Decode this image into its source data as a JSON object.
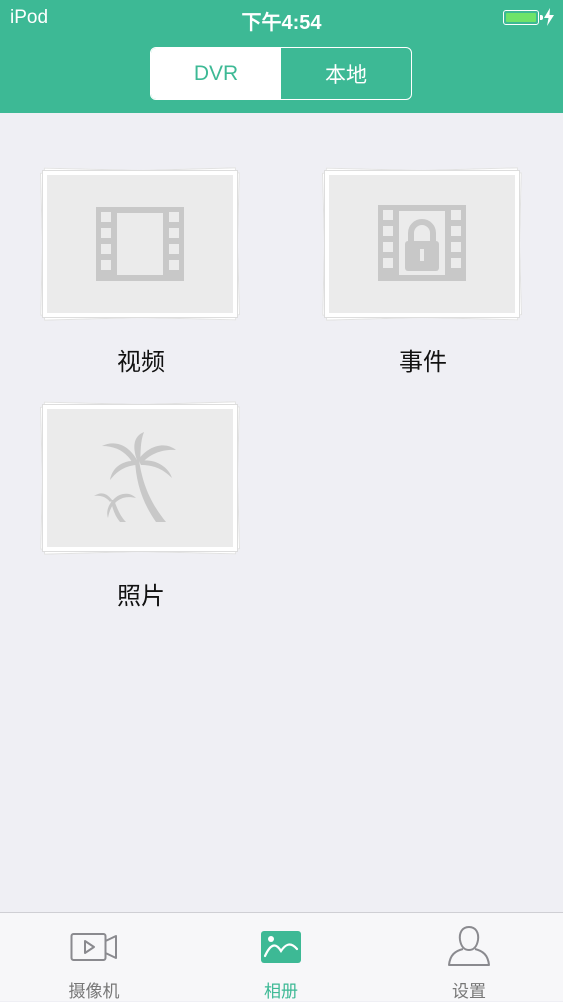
{
  "status_bar": {
    "carrier": "iPod",
    "time": "下午4:54",
    "battery_color": "#6ee36a"
  },
  "segment": {
    "options": [
      "DVR",
      "本地"
    ],
    "selected": "DVR"
  },
  "albums": [
    {
      "label": "视频",
      "icon": "film-icon"
    },
    {
      "label": "事件",
      "icon": "locked-film-icon"
    },
    {
      "label": "照片",
      "icon": "palm-tree-icon"
    }
  ],
  "tabbar": {
    "items": [
      {
        "label": "摄像机",
        "icon": "camera-icon"
      },
      {
        "label": "相册",
        "icon": "album-icon"
      },
      {
        "label": "设置",
        "icon": "person-icon"
      }
    ],
    "selected": "相册"
  },
  "colors": {
    "accent": "#3db995",
    "background": "#efeff4",
    "placeholder": "#ebebeb",
    "icon_gray": "#c8c8c8"
  }
}
